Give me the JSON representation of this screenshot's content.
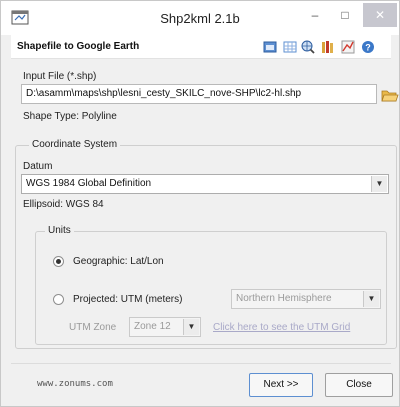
{
  "window": {
    "title": "Shp2kml 2.1b",
    "min_glyph": "–",
    "max_glyph": "□",
    "close_glyph": "✕"
  },
  "header": {
    "title": "Shapefile to Google Earth",
    "tools": [
      "window-icon",
      "grid-icon",
      "globe-icon",
      "books-icon",
      "chart-icon",
      "help-icon"
    ]
  },
  "input": {
    "label": "Input File (*.shp)",
    "value": "D:\\asamm\\maps\\shp\\lesni_cesty_SKILC_nove-SHP\\lc2-hl.shp",
    "shape_type": "Shape Type: Polyline"
  },
  "coordinate_system": {
    "legend": "Coordinate System",
    "datum_label": "Datum",
    "datum_value": "WGS 1984 Global Definition",
    "ellipsoid": "Ellipsoid: WGS 84"
  },
  "units": {
    "legend": "Units",
    "geographic_label": "Geographic: Lat/Lon",
    "geographic_checked": true,
    "projected_label": "Projected: UTM (meters)",
    "projected_checked": false,
    "hemisphere_value": "Northern Hemisphere",
    "utm_zone_label": "UTM Zone",
    "utm_zone_value": "Zone 12",
    "utm_grid_link": "Click here to see the UTM Grid"
  },
  "footer": {
    "website": "www.zonums.com",
    "next_label": "Next >>",
    "close_label": "Close"
  },
  "colors": {
    "accent": "#5d8fd1",
    "link": "#a9a9c8",
    "close_button": "#c7c7cf"
  }
}
